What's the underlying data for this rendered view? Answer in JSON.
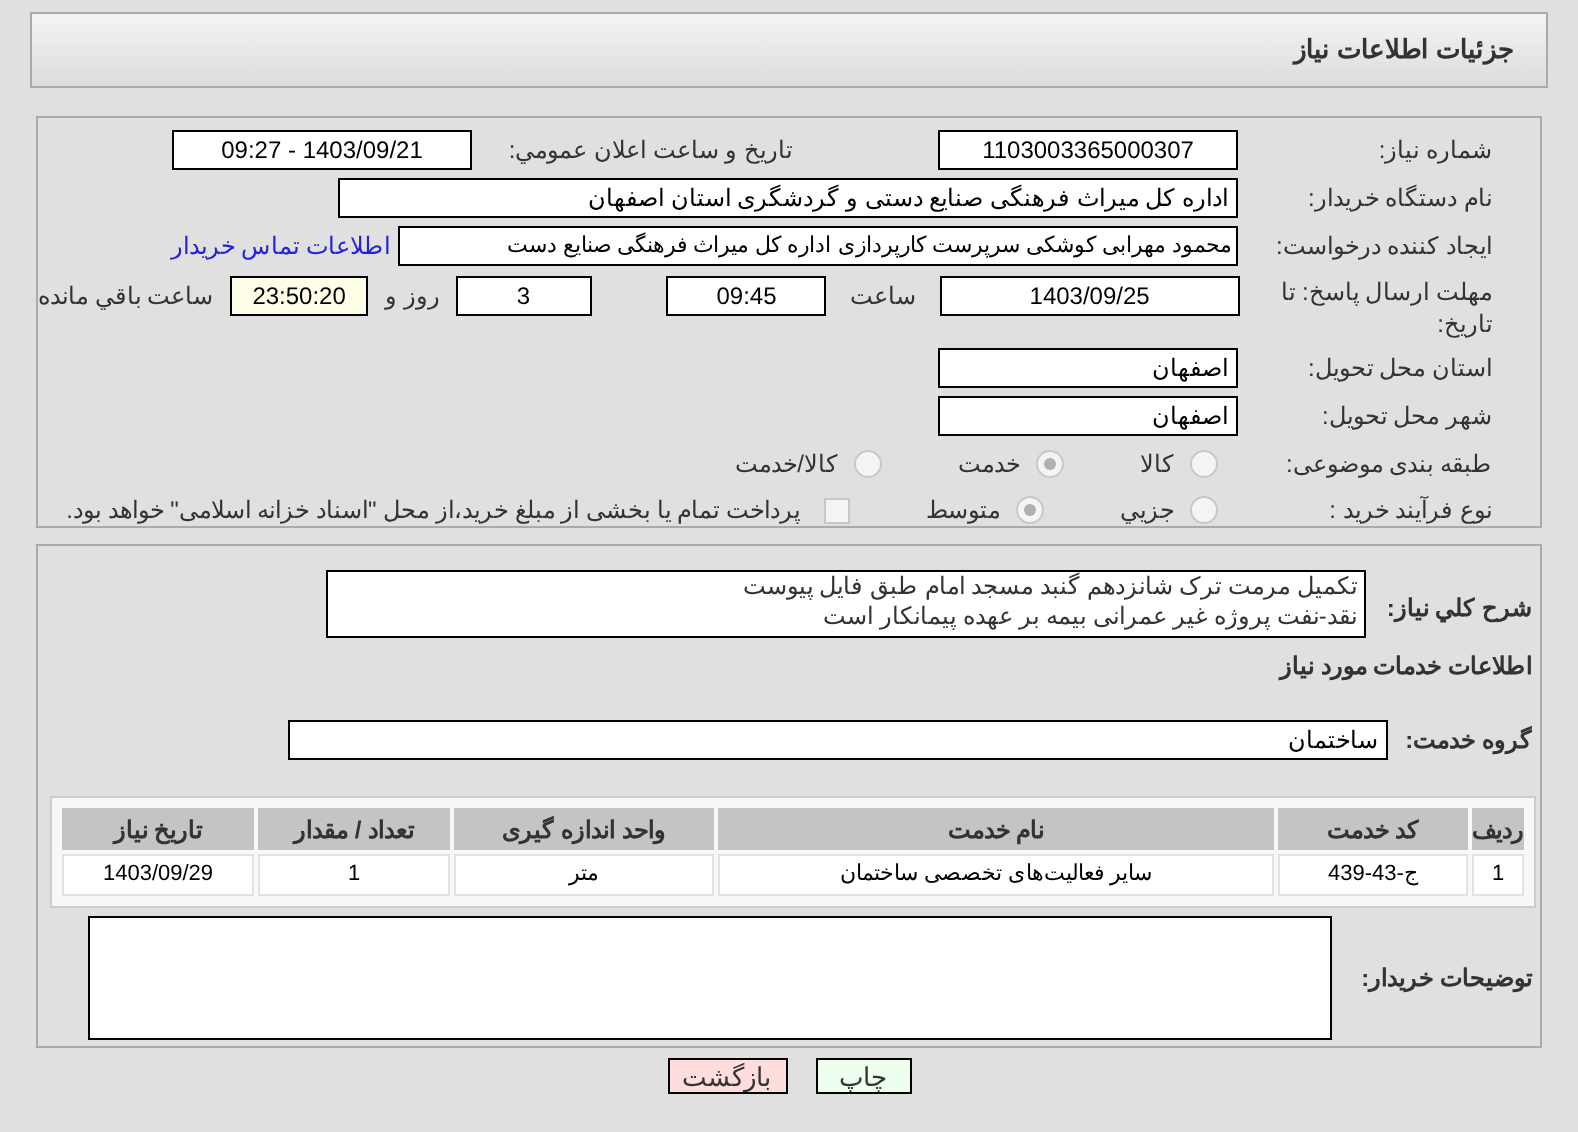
{
  "header": {
    "title": "جزئیات اطلاعات نیاز"
  },
  "details": {
    "need_number": {
      "label": "شماره نیاز:",
      "value": "1103003365000307"
    },
    "announce": {
      "label": "تاریخ و ساعت اعلان عمومي:",
      "value": "1403/09/21 - 09:27"
    },
    "buyer": {
      "label": "نام دستگاه خریدار:",
      "value": "اداره کل میراث فرهنگی  صنایع دستی و گردشگری استان اصفهان"
    },
    "creator": {
      "label": "ایجاد کننده درخواست:",
      "value": "محمود مهرابی کوشکی سرپرست کارپردازی اداره کل میراث فرهنگی  صنایع دست",
      "link": "اطلاعات تماس خریدار"
    },
    "deadline": {
      "label": "مهلت ارسال پاسخ: تا تاریخ:",
      "date": "1403/09/25",
      "time_label": "ساعت",
      "time": "09:45",
      "days": "3",
      "days_label": "روز و",
      "remaining": "23:50:20",
      "remaining_label": "ساعت باقي مانده"
    },
    "province": {
      "label": "استان محل تحویل:",
      "value": "اصفهان"
    },
    "city": {
      "label": "شهر محل تحویل:",
      "value": "اصفهان"
    },
    "category": {
      "label": "طبقه بندی موضوعی:",
      "options": [
        {
          "label": "کالا",
          "selected": false
        },
        {
          "label": "خدمت",
          "selected": true
        },
        {
          "label": "کالا/خدمت",
          "selected": false
        }
      ]
    },
    "process": {
      "label": "نوع فرآیند خرید :",
      "options": [
        {
          "label": "جزیي",
          "selected": false
        },
        {
          "label": "متوسط",
          "selected": true
        }
      ],
      "payment": {
        "checked": false,
        "text": "پرداخت تمام یا بخشی از مبلغ خرید،از محل \"اسناد خزانه اسلامی\" خواهد بود."
      }
    }
  },
  "description": {
    "label": "شرح کلي نیاز:",
    "value": "تکمیل مرمت ترک شانزدهم گنبد مسجد امام طبق فایل پیوست\nنقد-نفت پروژه غیر عمرانی بیمه بر عهده پیمانکار است"
  },
  "services": {
    "title": "اطلاعات خدمات مورد نیاز",
    "group_label": "گروه خدمت:",
    "group": "ساختمان",
    "columns": [
      "ردیف",
      "کد خدمت",
      "نام خدمت",
      "واحد اندازه گیری",
      "تعداد / مقدار",
      "تاریخ نیاز"
    ],
    "rows": [
      [
        "1",
        "ج-43-439",
        "سایر فعالیت‌های تخصصی ساختمان",
        "متر",
        "1",
        "1403/09/29"
      ]
    ]
  },
  "buyer_notes": {
    "label": "توضیحات خریدار:"
  },
  "buttons": [
    {
      "label": "چاپ",
      "kind": "print"
    },
    {
      "label": "بازگشت",
      "kind": "back"
    }
  ]
}
